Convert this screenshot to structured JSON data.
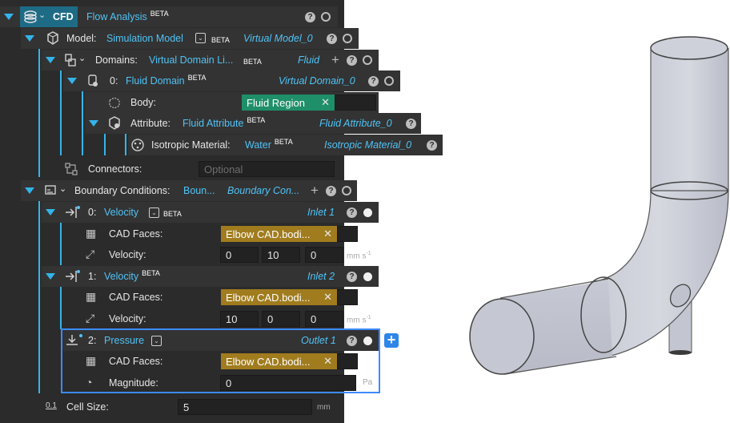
{
  "cfd": {
    "tag": "CFD",
    "title": "Flow Analysis",
    "beta": "BETA"
  },
  "model": {
    "label": "Model:",
    "value": "Simulation Model",
    "beta": "BETA",
    "ref": "Virtual Model_0"
  },
  "domains": {
    "label": "Domains:",
    "value": "Virtual Domain Li...",
    "beta": "BETA",
    "ref": "Fluid"
  },
  "fluid_domain": {
    "index": "0:",
    "value": "Fluid Domain",
    "beta": "BETA",
    "ref": "Virtual Domain_0"
  },
  "body": {
    "label": "Body:",
    "chip": "Fluid Region",
    "chip_x": "✕"
  },
  "attribute": {
    "label": "Attribute:",
    "value": "Fluid Attribute",
    "beta": "BETA",
    "ref": "Fluid Attribute_0"
  },
  "material": {
    "label": "Isotropic Material:",
    "value": "Water",
    "beta": "BETA",
    "ref": "Isotropic Material_0"
  },
  "connectors": {
    "label": "Connectors:",
    "placeholder": "Optional"
  },
  "boundary": {
    "label": "Boundary Conditions:",
    "value": "Boun...",
    "ref": "Boundary Con..."
  },
  "bc0": {
    "index": "0:",
    "type": "Velocity",
    "beta": "BETA",
    "ref": "Inlet 1",
    "cad_label": "CAD Faces:",
    "cad_chip": "Elbow CAD.bodi...",
    "vel_label": "Velocity:",
    "vx": "0",
    "vy": "10",
    "vz": "0",
    "unit": "mm s",
    "unit_exp": "-1"
  },
  "bc1": {
    "index": "1:",
    "type": "Velocity",
    "beta": "BETA",
    "ref": "Inlet 2",
    "cad_label": "CAD Faces:",
    "cad_chip": "Elbow CAD.bodi...",
    "vel_label": "Velocity:",
    "vx": "10",
    "vy": "0",
    "vz": "0",
    "unit": "mm s",
    "unit_exp": "-1"
  },
  "bc2": {
    "index": "2:",
    "type": "Pressure",
    "ref": "Outlet 1",
    "cad_label": "CAD Faces:",
    "cad_chip": "Elbow CAD.bodi...",
    "mag_label": "Magnitude:",
    "mag": "0",
    "unit": "Pa"
  },
  "cell": {
    "icon_text": "0.1",
    "label": "Cell Size:",
    "value": "5",
    "unit": "mm"
  },
  "icons": {
    "help": "?",
    "close": "✕",
    "plus": "+",
    "add": "+"
  },
  "colors": {
    "accent": "#34b4ea",
    "link": "#4fc3f7",
    "green_chip": "#1f8f6a",
    "yellow_chip": "#a07c1e",
    "select": "#3d8bfd"
  }
}
